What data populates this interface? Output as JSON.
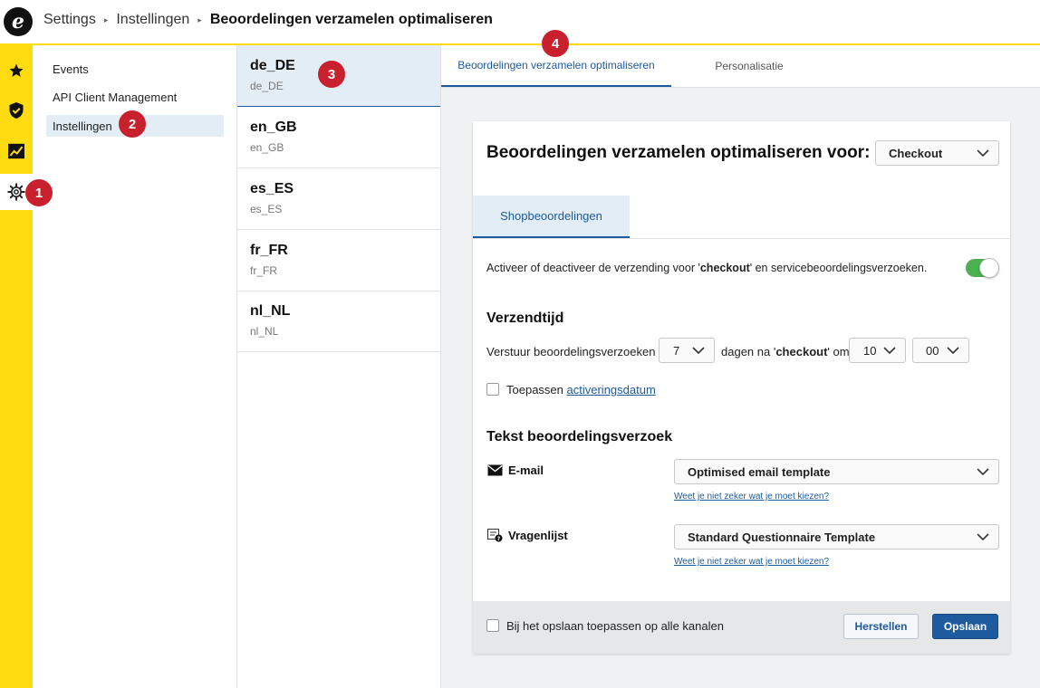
{
  "breadcrumb": {
    "items": [
      "Settings",
      "Instellingen"
    ],
    "current": "Beoordelingen verzamelen optimaliseren",
    "separator": "▸"
  },
  "logo": {
    "letter": "e"
  },
  "rail": {
    "items": [
      {
        "name": "star-icon"
      },
      {
        "name": "shield-check-icon"
      },
      {
        "name": "chart-icon"
      },
      {
        "name": "gear-icon",
        "active": true
      }
    ]
  },
  "subnav": {
    "items": [
      "Events",
      "API Client Management",
      "Instellingen"
    ],
    "active": "Instellingen"
  },
  "locales": [
    {
      "code": "de_DE",
      "sub": "de_DE",
      "active": true
    },
    {
      "code": "en_GB",
      "sub": "en_GB"
    },
    {
      "code": "es_ES",
      "sub": "es_ES"
    },
    {
      "code": "fr_FR",
      "sub": "fr_FR"
    },
    {
      "code": "nl_NL",
      "sub": "nl_NL"
    }
  ],
  "tabs": [
    {
      "label": "Beoordelingen verzamelen optimaliseren",
      "active": true
    },
    {
      "label": "Personalisatie"
    }
  ],
  "card": {
    "title": "Beoordelingen verzamelen optimaliseren voor:",
    "channel_select": "Checkout",
    "inner_tab": "Shopbeoordelingen",
    "activate_text_before": "Activeer of deactiveer de verzending voor '",
    "activate_text_bold": "checkout",
    "activate_text_after": "' en servicebeoordelingsverzoeken.",
    "toggle_on": true,
    "send_time": {
      "title": "Verzendtijd",
      "prefix": "Verstuur beoordelingsverzoeken",
      "days_value": "7",
      "middle_before": "dagen na '",
      "middle_bold": "checkout",
      "middle_after": "' om",
      "hour_value": "10",
      "minute_value": "00"
    },
    "apply_activation": {
      "label": "Toepassen",
      "link": "activeringsdatum"
    },
    "request_text": {
      "title": "Tekst beoordelingsverzoek",
      "email_label": "E-mail",
      "email_select": "Optimised email template",
      "email_help": "Weet je niet zeker wat je moet kiezen?",
      "questionnaire_label": "Vragenlijst",
      "questionnaire_select": "Standard Questionnaire Template",
      "questionnaire_help": "Weet je niet zeker wat je moet kiezen?"
    },
    "footer": {
      "apply_all_label": "Bij het opslaan toepassen op alle kanalen",
      "reset_label": "Herstellen",
      "save_label": "Opslaan"
    }
  },
  "markers": [
    "1",
    "2",
    "3",
    "4"
  ],
  "colors": {
    "brand_yellow": "#ffdc0f",
    "accent_blue": "#1d5a9e",
    "marker_red": "#c8202d",
    "toggle_green": "#4caf50",
    "active_bg": "#e3edf5"
  }
}
